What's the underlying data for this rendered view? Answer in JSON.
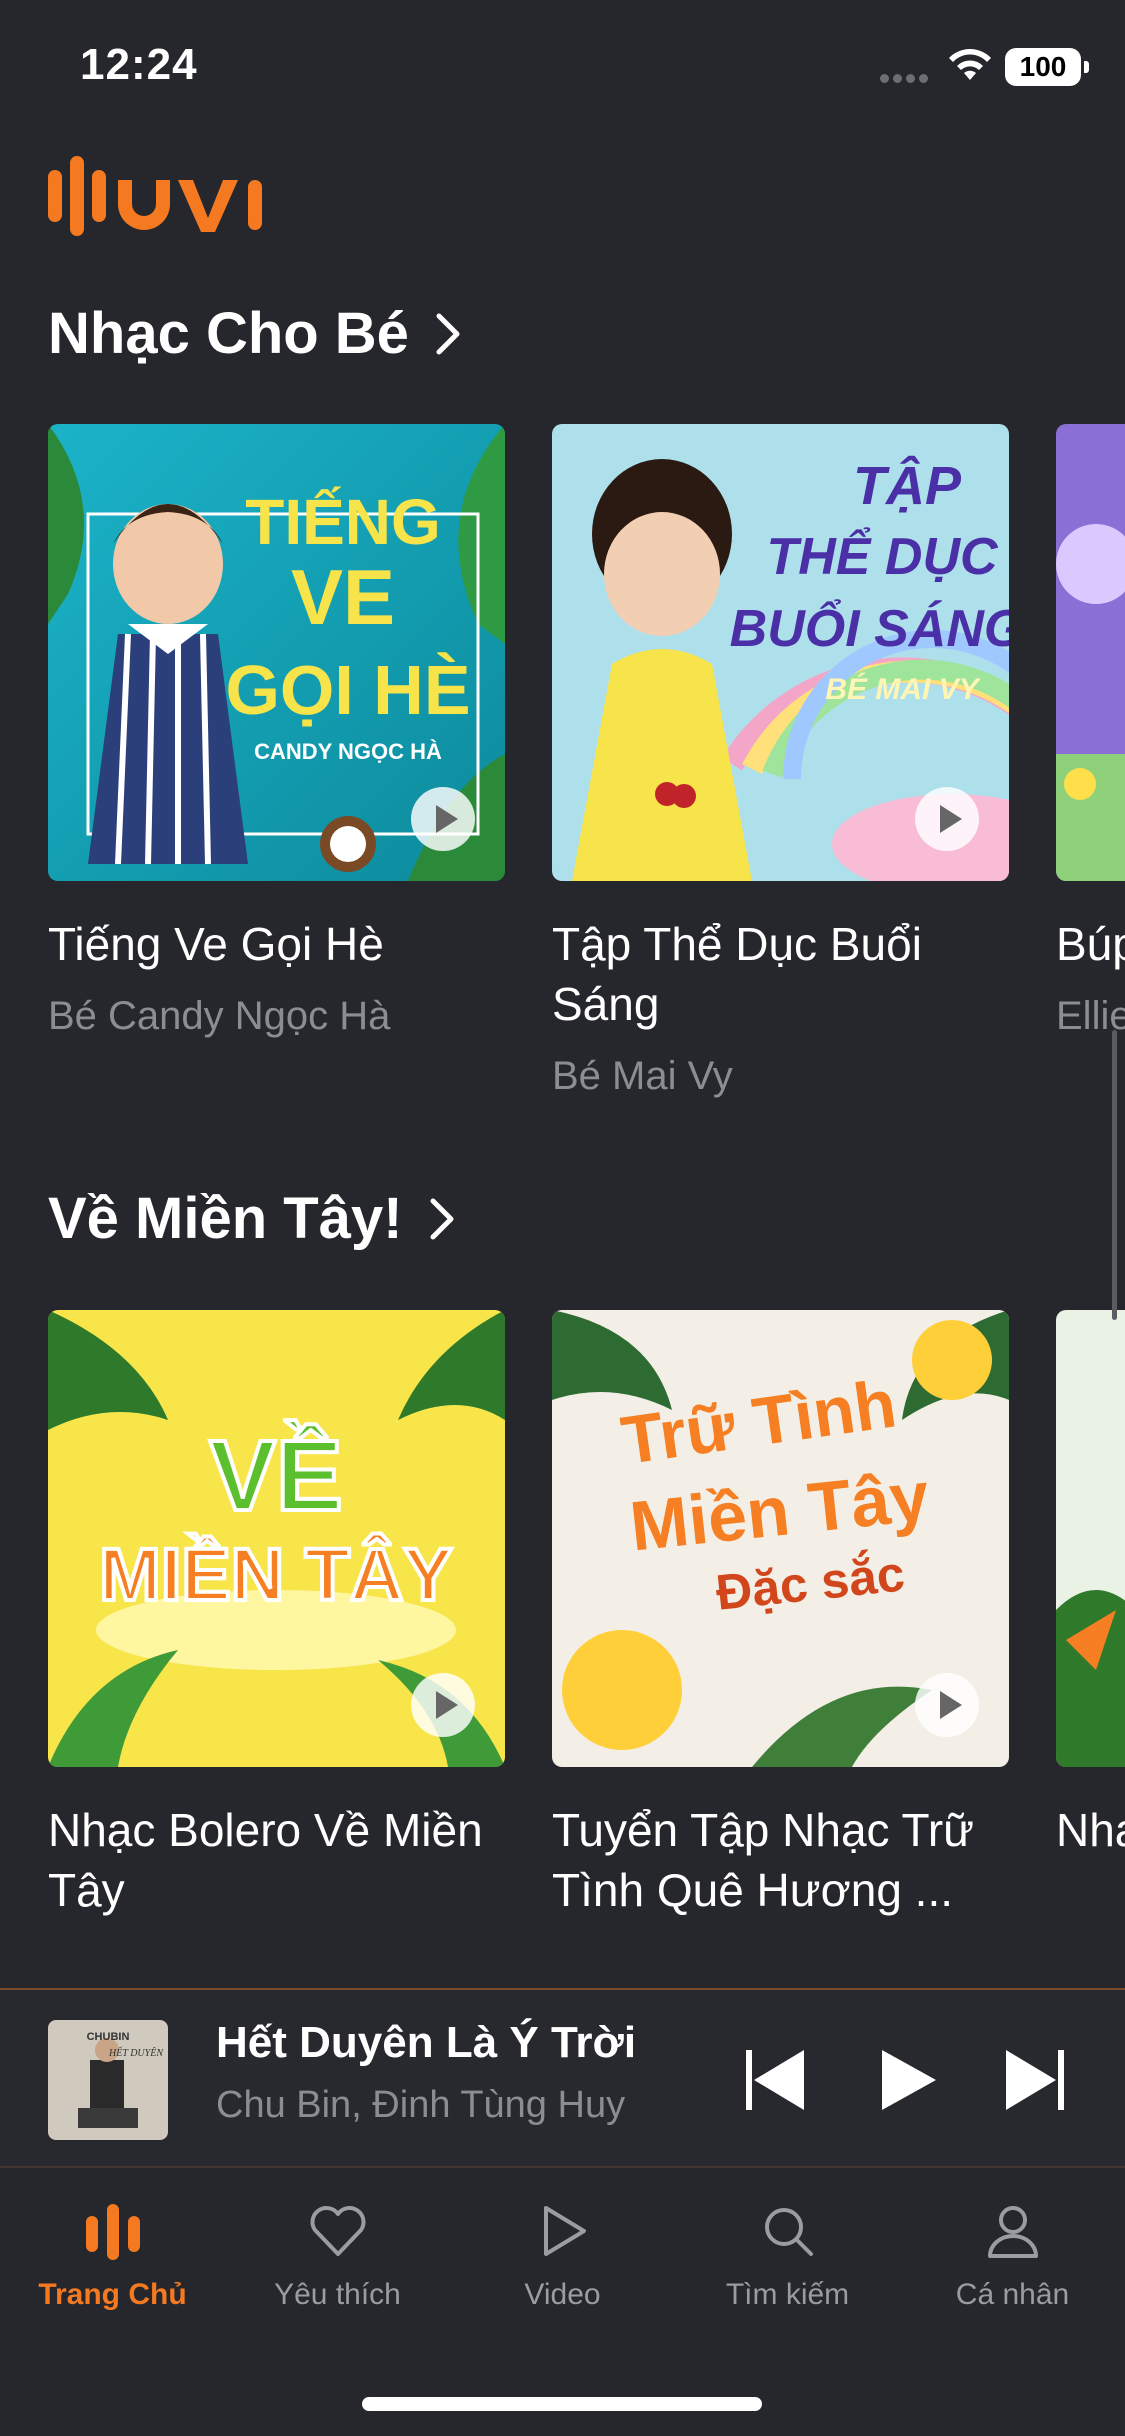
{
  "status_bar": {
    "time": "12:24",
    "battery": "100"
  },
  "app": {
    "logo_text": "MUVI",
    "accent": "#F47920"
  },
  "sections": [
    {
      "title": "Nhạc Cho Bé",
      "items": [
        {
          "title": "Tiếng Ve Gọi Hè",
          "artist": "Bé Candy Ngọc Hà",
          "art_text": [
            "TIẾNG",
            "VE",
            "GỌI HÈ",
            "CANDY NGỌC HÀ"
          ]
        },
        {
          "title": "Tập Thể Dục Buổi Sáng",
          "artist": "Bé Mai Vy",
          "art_text": [
            "TẬP",
            "THỂ DỤC",
            "BUỔI SÁNG",
            "BÉ MAI VY"
          ]
        },
        {
          "title": "Búp",
          "artist": "Ellie"
        }
      ]
    },
    {
      "title": "Về Miền Tây!",
      "items": [
        {
          "title": "Nhạc Bolero Về Miền Tây",
          "art_text": [
            "VỀ",
            "MIỀN TÂY"
          ]
        },
        {
          "title": "Tuyển Tập Nhạc Trữ Tình Quê Hương ...",
          "art_text": [
            "Trữ Tình",
            "Miền Tây",
            "Đặc sắc"
          ]
        },
        {
          "title": "Nhạ"
        }
      ]
    }
  ],
  "player": {
    "song": "Hết Duyên Là Ý Trời",
    "artist": "Chu Bin, Đinh Tùng Huy",
    "cover_text": [
      "CHUBIN",
      "HẾT DUYÊN"
    ]
  },
  "tabs": [
    {
      "label": "Trang Chủ",
      "icon": "home-logo-icon",
      "active": true
    },
    {
      "label": "Yêu thích",
      "icon": "heart-icon"
    },
    {
      "label": "Video",
      "icon": "play-icon"
    },
    {
      "label": "Tìm kiếm",
      "icon": "search-icon"
    },
    {
      "label": "Cá nhân",
      "icon": "user-icon"
    }
  ]
}
